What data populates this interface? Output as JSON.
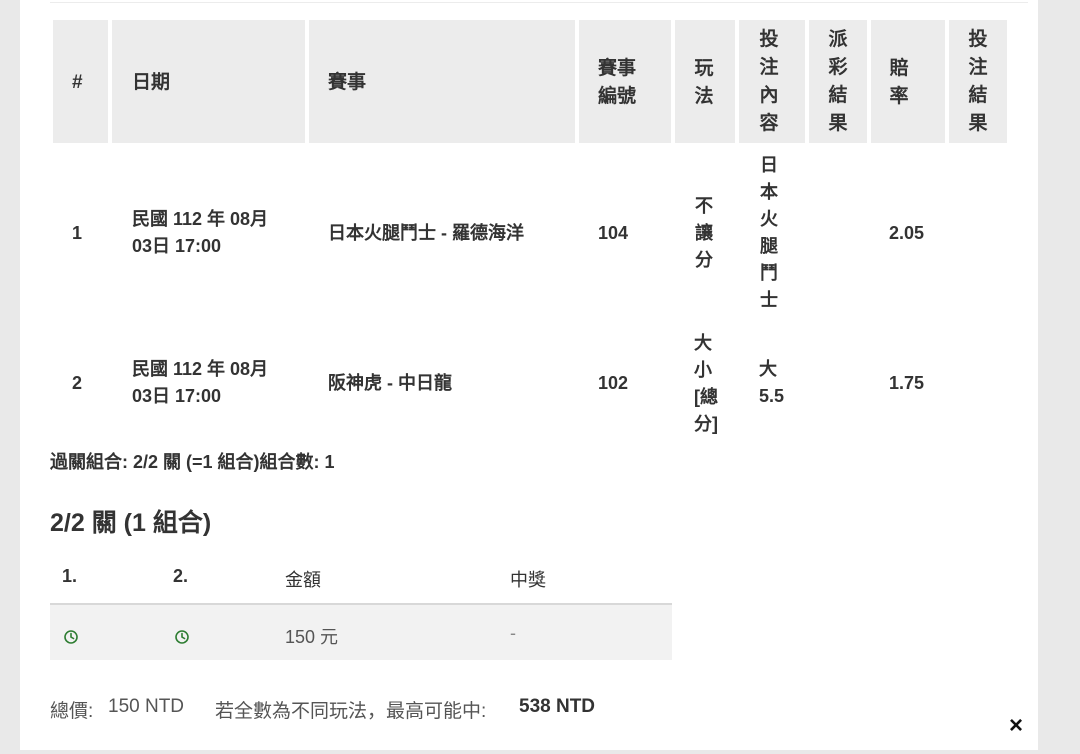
{
  "table": {
    "headers": {
      "index": "#",
      "date": "日期",
      "event": "賽事",
      "event_no": "賽事編號",
      "play": "玩法",
      "bet": "投注內容",
      "payout": "派彩結果",
      "odds": "賠率",
      "result": "投注結果"
    },
    "rows": [
      {
        "index": "1",
        "date": "民國 112 年 08月 03日 17:00",
        "event": "日本火腿鬥士 - 羅德海洋",
        "event_no": "104",
        "play": "不讓分",
        "bet": "日本火腿鬥士",
        "payout": "",
        "odds": "2.05",
        "result": ""
      },
      {
        "index": "2",
        "date": "民國 112 年 08月 03日 17:00",
        "event": "阪神虎 - 中日龍",
        "event_no": "102",
        "play": "大小[總分]",
        "bet": "大 5.5",
        "payout": "",
        "odds": "1.75",
        "result": ""
      }
    ]
  },
  "combo_summary": "過關組合: 2/2 關 (=1 組合)組合數: 1",
  "section_title": "2/2 關 (1 組合)",
  "combo_table": {
    "headers": {
      "c1": "1.",
      "c2": "2.",
      "amount": "金額",
      "prize": "中獎"
    },
    "row": {
      "icon1": "clock-icon",
      "icon2": "clock-icon",
      "amount": "150 元",
      "prize": "-"
    },
    "icon_color": "#2e7d32"
  },
  "footer": {
    "total_label": "總價:",
    "total_value": "150 NTD",
    "max_label": "若全數為不同玩法，最高可能中:",
    "max_value": "538 NTD"
  },
  "close": "×"
}
